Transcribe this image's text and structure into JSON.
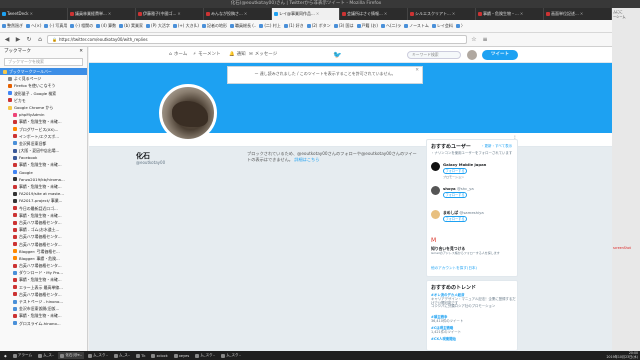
{
  "window": {
    "title": "化石(@eoutkotay00)さん | Twitterから非表示ツイート - Mozilla Firefox"
  },
  "tabs": [
    {
      "label": "TweetDeck",
      "color": "#1da1f2"
    },
    {
      "label": "議員林業経費単...",
      "color": "#c33"
    },
    {
      "label": "伊藤雅子(中國ゴ...",
      "color": "#c33"
    },
    {
      "label": "みんなが投稿さ...",
      "color": "#c33"
    },
    {
      "label": "レイ@事業同作品...",
      "color": "#1da1f2"
    },
    {
      "label": "会議所はさぐ情報...",
      "color": "#c33"
    },
    {
      "label": "シルエスクリアト...",
      "color": "#c33"
    },
    {
      "label": "事績・危険生物・...",
      "color": "#c33"
    },
    {
      "label": "画面単位記述...",
      "color": "#c33"
    }
  ],
  "bookmarks": [
    "整然過ぎ",
    "ヘ(×)",
    "(-) 写真用",
    "(-) 相関の",
    "(4) 算数",
    "(b) 実業家",
    "(P) 大活字",
    "(+) 大き(L)",
    "記者の地形",
    "職員総長 (..",
    "(二) 村上",
    "(1) 好き",
    "(2) ボタン",
    "(3) 国は",
    "戸籍 (お)",
    "ヘ(二)ラ",
    "ノーストム",
    "レイ会料",
    "〉"
  ],
  "url": "https://twitter.com/eoutkotay00/with_replies",
  "sidebar": {
    "title": "ブックマーク",
    "search_placeholder": "ブックマークを検索",
    "items": [
      {
        "label": "ブックマークツールバー",
        "indent": 0,
        "selected": true,
        "color": "#f5c84a"
      },
      {
        "label": "よく見るページ",
        "indent": 1,
        "color": "#888"
      },
      {
        "label": "Firefox を使いこなそう",
        "indent": 1,
        "color": "#e66000"
      },
      {
        "label": "波形量子 - Google 検索",
        "indent": 1,
        "color": "#4285f4"
      },
      {
        "label": "ピカモ",
        "indent": 1,
        "color": "#c33"
      },
      {
        "label": "Google Chrome から",
        "indent": 1,
        "color": "#f5c84a"
      },
      {
        "label": "phpMyAdmin",
        "indent": 2,
        "color": "#e47"
      },
      {
        "label": "事績・危険生物・未確...",
        "indent": 2,
        "color": "#c33"
      },
      {
        "label": "ブログサービス(XX)...",
        "indent": 2,
        "color": "#f80"
      },
      {
        "label": "インポート/エクスポ...",
        "indent": 2,
        "color": "#c33"
      },
      {
        "label": "金沢昇旧東旧都",
        "indent": 2,
        "color": "#4a90d9"
      },
      {
        "label": "[大阪・夏因中店出場...",
        "indent": 2,
        "color": "#3b5998"
      },
      {
        "label": "Facebook",
        "indent": 2,
        "color": "#3b5998"
      },
      {
        "label": "事績・危険生物・未確...",
        "indent": 2,
        "color": "#c33"
      },
      {
        "label": "Google",
        "indent": 2,
        "color": "#4285f4"
      },
      {
        "label": "Fanzo2019/kb/hiroma...",
        "indent": 2,
        "color": "#333"
      },
      {
        "label": "事績・危険生物・未確...",
        "indent": 2,
        "color": "#c33"
      },
      {
        "label": "FA2019/site at maste...",
        "indent": 2,
        "color": "#333"
      },
      {
        "label": "FA2017-project/ 事業...",
        "indent": 2,
        "color": "#333"
      },
      {
        "label": "今日の最新話近ロゴ...",
        "indent": 2,
        "color": "#c33"
      },
      {
        "label": "事績・危険生物・未確...",
        "indent": 2,
        "color": "#c33"
      },
      {
        "label": "古英ハワ場価格センタ...",
        "indent": 2,
        "color": "#c33"
      },
      {
        "label": "事績 - ゴム(お水道土...",
        "indent": 2,
        "color": "#c33"
      },
      {
        "label": "古英ハワ場価格センタ...",
        "indent": 2,
        "color": "#c33"
      },
      {
        "label": "古英ハワ場価格センタ...",
        "indent": 2,
        "color": "#c33"
      },
      {
        "label": "Blogger: 弓場価格セ...",
        "indent": 2,
        "color": "#f80"
      },
      {
        "label": "Blogger: 事績・危険...",
        "indent": 2,
        "color": "#f80"
      },
      {
        "label": "古英ハワ場価格センタ...",
        "indent": 2,
        "color": "#c33"
      },
      {
        "label": "ダウンロード・My Pro...",
        "indent": 2,
        "color": "#4a90d9"
      },
      {
        "label": "事績・危険生物・未確...",
        "indent": 2,
        "color": "#c33"
      },
      {
        "label": "エラー上表示 最高単線...",
        "indent": 2,
        "color": "#c33"
      },
      {
        "label": "古英ハワ場価格センタ...",
        "indent": 2,
        "color": "#c33"
      },
      {
        "label": "テストページ - hinono...",
        "indent": 2,
        "color": "#4a90d9"
      },
      {
        "label": "金沢市旧東仮開(旧仮...",
        "indent": 2,
        "color": "#4a90d9"
      },
      {
        "label": "事績・危険生物・未確...",
        "indent": 2,
        "color": "#c33"
      },
      {
        "label": "グロスライム-hinono...",
        "indent": 2,
        "color": "#4a90d9"
      }
    ]
  },
  "twitter": {
    "nav": {
      "home": "ホーム",
      "moments": "モーメント",
      "notifications": "通知",
      "messages": "メッセージ"
    },
    "search_placeholder": "キーワード検索",
    "tweet_button": "ツイート",
    "notice": "ー 達し読みされました / このツイートを表示することを許可されていません。",
    "profile_name": "化石",
    "profile_handle": "@eoutkotay00",
    "block_message": "ブロックされているため、@eoutkotay00さんのフォローや@eoutkotay00さんのツイートの表示はできません。",
    "block_link": "詳細はこちら",
    "who_to_follow": {
      "title": "おすすめユーザー",
      "links": "・更新・すべて表示",
      "subtitle": "・ナリンコンを使用ユーザーをフォローされています",
      "users": [
        {
          "name": "Galaxy Mobile Japan",
          "handle": "",
          "button": "フォローする",
          "promo": "プロモーション",
          "color": "#111"
        },
        {
          "name": "shoya",
          "handle": "@shc_ya",
          "button": "フォローする",
          "promo": "",
          "color": "#555"
        },
        {
          "name": "まめしば",
          "handle": "@sameshiya",
          "button": "フォローする",
          "promo": "",
          "color": "#e8c080"
        }
      ],
      "gmail_title": "知り合いを見つける",
      "gmail_desc": "Gmailのアドレス帳からフォローする人を探します",
      "more": "他のアカウントを探す(日本)"
    },
    "trends": {
      "title": "おすすめのトレンド",
      "items": [
        {
          "tag": "#オレ流のデカメ経済",
          "sub": "キャリアデザイン・マニュアル記法！企業に登録するだけで公開可能です"
        },
        {
          "tag": "",
          "sub": "コシシパに分類ロシア社のプロモーション"
        },
        {
          "tag": "#頭主戦争",
          "sub": "36,410件のツイート"
        },
        {
          "tag": "#Cは現主戦略",
          "sub": "1,421件のツイート"
        },
        {
          "tag": "#CX人現業開始",
          "sub": ""
        }
      ]
    }
  },
  "bgwindow": {
    "lines": [
      "ムにに",
      "ーシーム",
      "",
      "",
      "",
      "",
      "",
      "",
      "",
      "",
      "",
      "",
      "",
      "",
      "",
      "",
      "",
      "",
      "",
      "",
      "",
      "",
      "",
      "",
      "",
      "",
      "",
      "",
      "",
      "",
      "",
      "",
      "",
      "",
      "",
      "",
      "",
      "",
      "",
      "",
      "",
      "",
      "",
      "",
      "",
      "",
      "",
      "",
      "",
      "",
      "",
      "",
      "",
      "",
      "",
      "",
      "",
      "",
      "",
      "",
      "",
      "",
      "",
      "",
      "",
      "",
      "",
      "",
      "",
      "",
      "",
      ""
    ],
    "red_text": "screenShot"
  },
  "taskbar": {
    "items": [
      {
        "label": "アラーム",
        "active": false
      },
      {
        "label": "ム_ス..",
        "active": false
      },
      {
        "label": "化石(@e..",
        "active": true
      },
      {
        "label": "ム_スク..",
        "active": false
      },
      {
        "label": "ム_ス..",
        "active": false
      },
      {
        "label": "Tk",
        "active": false
      },
      {
        "label": "xclock",
        "active": false
      },
      {
        "label": "xeyes",
        "active": false
      },
      {
        "label": "ム_スク..",
        "active": false
      },
      {
        "label": "ム_スク..",
        "active": false
      }
    ],
    "time": "20:00",
    "date": "2019年10月23日(水)"
  }
}
